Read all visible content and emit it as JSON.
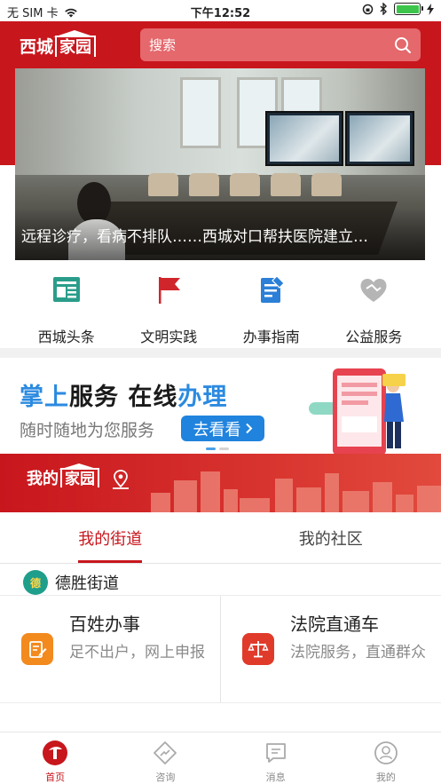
{
  "status_bar": {
    "carrier": "无 SIM 卡",
    "time": "下午12:52"
  },
  "header": {
    "logo_text_1": "西城",
    "logo_text_2": "家园",
    "search_placeholder": "搜索"
  },
  "banner": {
    "caption": "远程诊疗，看病不排队……西城对口帮扶医院建立…"
  },
  "quick_nav": [
    {
      "label": "西城头条",
      "icon": "news-icon",
      "color": "#2a9d8a"
    },
    {
      "label": "文明实践",
      "icon": "flag-icon",
      "color": "#d0262b"
    },
    {
      "label": "办事指南",
      "icon": "guide-doc-icon",
      "color": "#2b7fd6"
    },
    {
      "label": "公益服务",
      "icon": "charity-heart-icon",
      "color": "#b5b5b5"
    }
  ],
  "promo": {
    "title_part1": "掌上",
    "title_part2": "服务 在线",
    "title_part3": "办理",
    "subtitle": "随时随地为您服务",
    "button_label": "去看看"
  },
  "my_home": {
    "text_1": "我的",
    "text_2": "家园"
  },
  "tabs": [
    {
      "label": "我的街道",
      "active": true
    },
    {
      "label": "我的社区",
      "active": false
    }
  ],
  "street": {
    "name": "德胜街道",
    "badge": "德"
  },
  "services": [
    {
      "title": "百姓办事",
      "desc": "足不出户，网上申报",
      "icon": "form-edit-icon",
      "color": "#f28a1d"
    },
    {
      "title": "法院直通车",
      "desc": "法院服务，直通群众",
      "icon": "scales-icon",
      "color": "#e03a2a"
    }
  ],
  "tab_bar": [
    {
      "label": "首页",
      "icon": "home-logo-icon",
      "active": true
    },
    {
      "label": "咨询",
      "icon": "consult-icon",
      "active": false
    },
    {
      "label": "消息",
      "icon": "message-icon",
      "active": false
    },
    {
      "label": "我的",
      "icon": "profile-icon",
      "active": false
    }
  ]
}
